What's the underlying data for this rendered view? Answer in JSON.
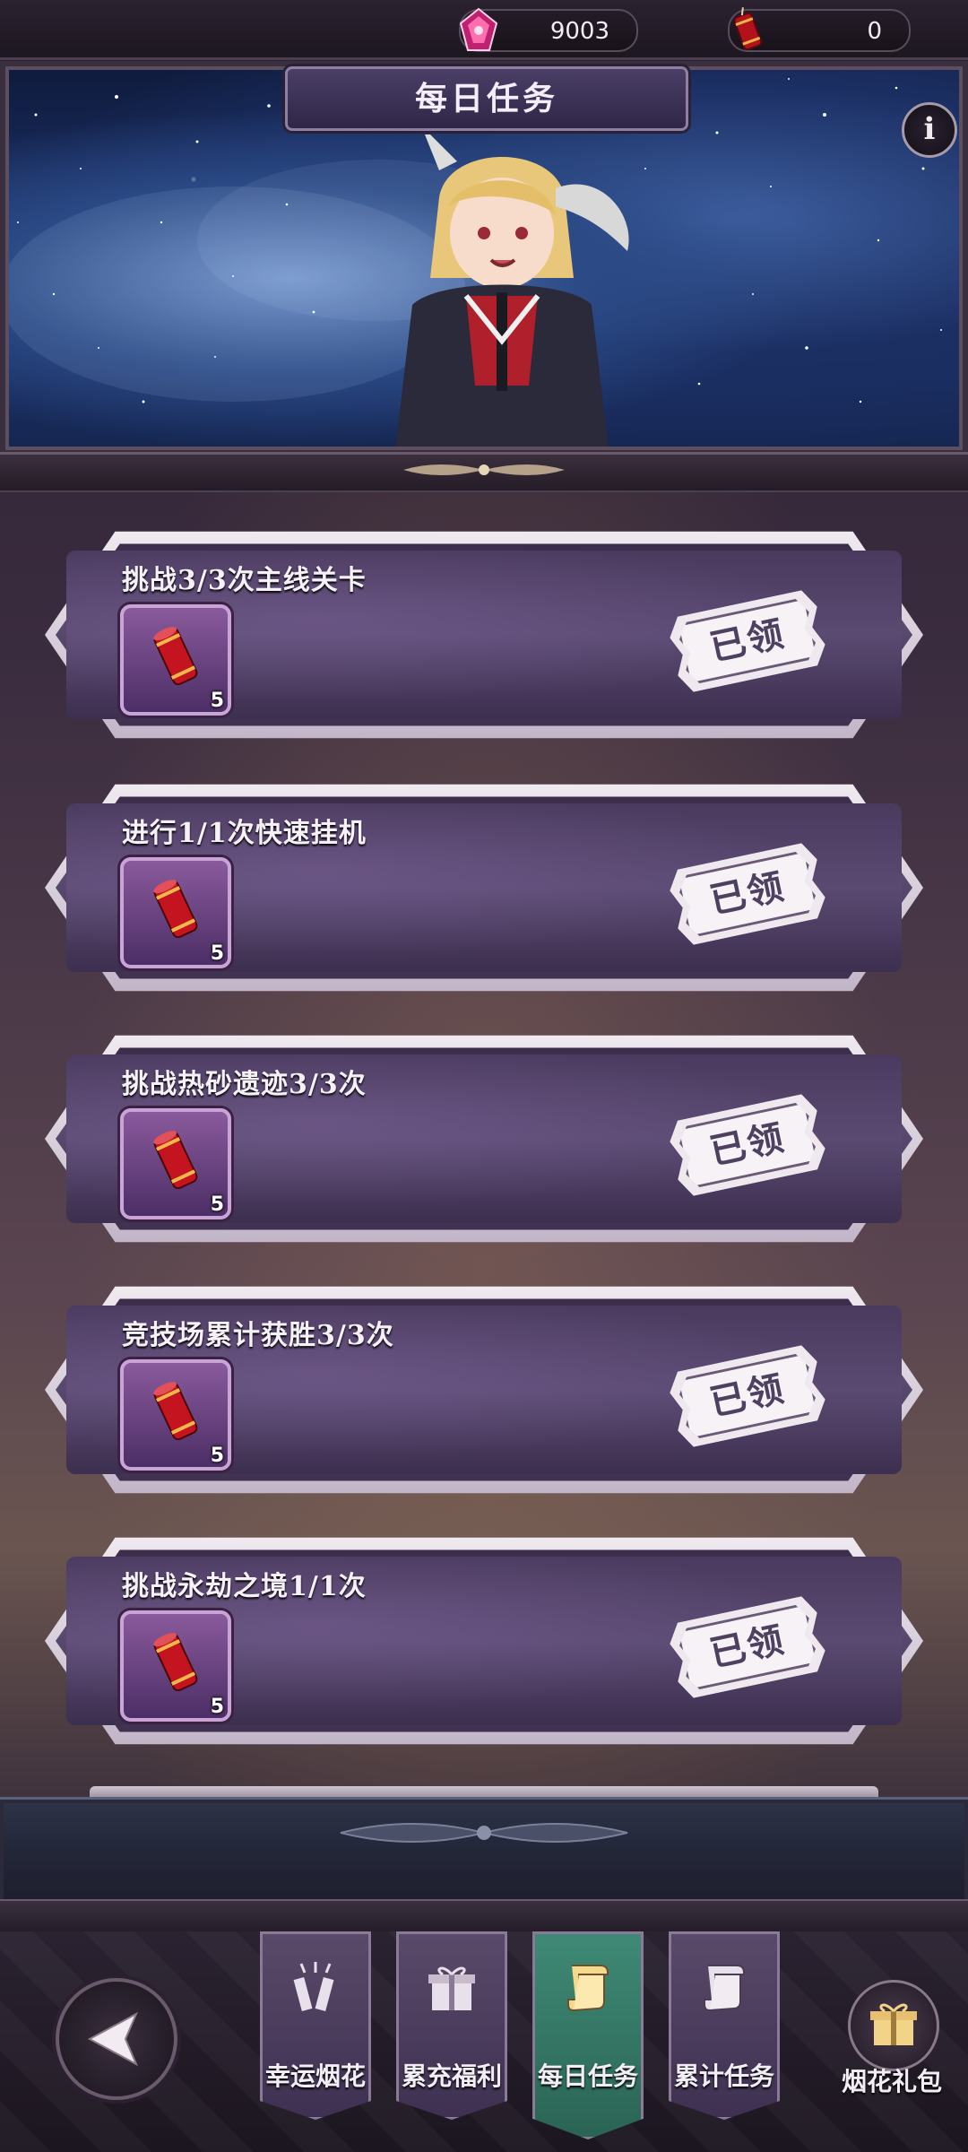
{
  "topbar": {
    "currencies": [
      {
        "icon": "pink-gem-icon",
        "value": "9003"
      },
      {
        "icon": "red-firecracker-icon",
        "value": "0"
      }
    ]
  },
  "header": {
    "title": "每日任务",
    "info_icon": "info-icon"
  },
  "tasks": [
    {
      "title": "挑战3/3次主线关卡",
      "reward_icon": "red-firecracker-icon",
      "reward_count": "5",
      "status": "已领"
    },
    {
      "title": "进行1/1次快速挂机",
      "reward_icon": "red-firecracker-icon",
      "reward_count": "5",
      "status": "已领"
    },
    {
      "title": "挑战热砂遗迹3/3次",
      "reward_icon": "red-firecracker-icon",
      "reward_count": "5",
      "status": "已领"
    },
    {
      "title": "竞技场累计获胜3/3次",
      "reward_icon": "red-firecracker-icon",
      "reward_count": "5",
      "status": "已领"
    },
    {
      "title": "挑战永劫之境1/1次",
      "reward_icon": "red-firecracker-icon",
      "reward_count": "5",
      "status": "已领"
    }
  ],
  "nav": {
    "back_icon": "back-arrow-icon",
    "tabs": [
      {
        "label": "幸运烟花",
        "icon": "firework-icon",
        "active": false
      },
      {
        "label": "累充福利",
        "icon": "gift-box-icon",
        "active": false
      },
      {
        "label": "每日任务",
        "icon": "scroll-icon",
        "active": true
      },
      {
        "label": "累计任务",
        "icon": "scroll-icon",
        "active": false
      }
    ],
    "gift_pack_label": "烟花礼包",
    "gift_pack_icon": "gift-box-icon"
  },
  "colors": {
    "active_tab": "#3f8a76",
    "card_purple": "#5a4a72",
    "stamp_text": "#4e4060"
  }
}
